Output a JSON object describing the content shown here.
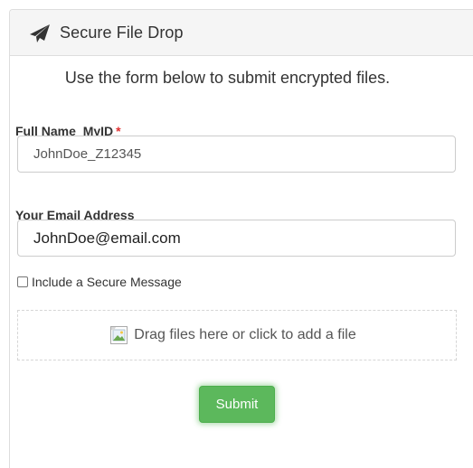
{
  "header": {
    "title": "Secure File Drop",
    "icon": "paper-plane-icon"
  },
  "intro": {
    "text": "Use the form below to submit encrypted files."
  },
  "name_field": {
    "label": "Full Name_MyID",
    "required_marker": "*",
    "value": "JohnDoe_Z12345"
  },
  "email_field": {
    "label": "Your Email Address",
    "value": "JohnDoe@email.com"
  },
  "secure_message": {
    "label": "Include a Secure Message",
    "checked": false
  },
  "dropzone": {
    "text": "Drag files here or click to add a file",
    "icon": "broken-image-icon"
  },
  "submit": {
    "label": "Submit"
  },
  "colors": {
    "accent_green": "#5cb85c",
    "required_red": "#e02f2f",
    "header_bg": "#f5f5f5"
  }
}
